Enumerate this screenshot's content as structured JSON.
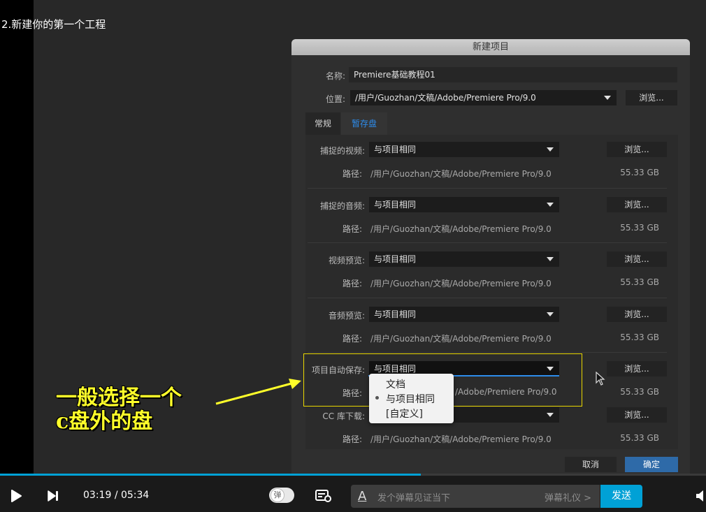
{
  "video": {
    "title": "2.新建你的第一个工程"
  },
  "dialog": {
    "title": "新建项目",
    "name_label": "名称:",
    "name_value": "Premiere基础教程01",
    "location_label": "位置:",
    "location_value": "/用户/Guozhan/文稿/Adobe/Premiere Pro/9.0",
    "browse_label": "浏览...",
    "tabs": [
      {
        "label": "常规",
        "active": false
      },
      {
        "label": "暂存盘",
        "active": true
      }
    ],
    "path_label": "路径:",
    "scratch_rows": [
      {
        "label": "捕捉的视频:",
        "value": "与项目相同",
        "path": "/用户/Guozhan/文稿/Adobe/Premiere Pro/9.0",
        "size": "55.33 GB"
      },
      {
        "label": "捕捉的音频:",
        "value": "与项目相同",
        "path": "/用户/Guozhan/文稿/Adobe/Premiere Pro/9.0",
        "size": "55.33 GB"
      },
      {
        "label": "视频预览:",
        "value": "与项目相同",
        "path": "/用户/Guozhan/文稿/Adobe/Premiere Pro/9.0",
        "size": "55.33 GB"
      },
      {
        "label": "音频预览:",
        "value": "与项目相同",
        "path": "/用户/Guozhan/文稿/Adobe/Premiere Pro/9.0",
        "size": "55.33 GB"
      },
      {
        "label": "项目自动保存:",
        "value": "与项目相同",
        "path": "/Adobe/Premiere Pro/9.0",
        "size": "55.33 GB"
      },
      {
        "label": "CC 库下载:",
        "value": "",
        "path": "/用户/Guozhan/文稿/Adobe/Premiere Pro/9.0",
        "size": "55.33 GB"
      }
    ],
    "dropdown_options": [
      {
        "label": "文档",
        "selected": false
      },
      {
        "label": "与项目相同",
        "selected": true
      },
      {
        "label": "[自定义]",
        "selected": false
      }
    ],
    "cancel_label": "取消",
    "ok_label": "确定"
  },
  "annotation": {
    "line1": "一般选择一个",
    "line2": "c盘外的盘"
  },
  "player": {
    "current_time": "03:19",
    "time_separator": "/",
    "duration": "05:34",
    "progress_fraction": 0.596,
    "danmaku_toggle_label": "弹",
    "danmaku_placeholder": "发个弹幕见证当下",
    "danmaku_etiquette": "弹幕礼仪 >",
    "send_label": "发送",
    "accent_color": "#00a1d6"
  }
}
